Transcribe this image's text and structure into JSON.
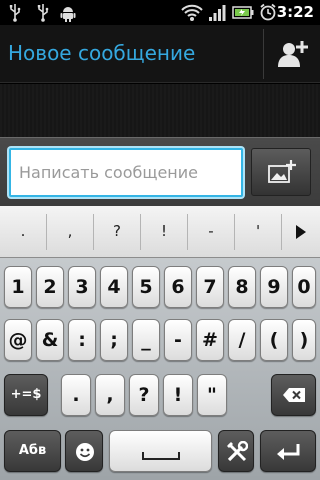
{
  "status_bar": {
    "time": "3:22",
    "icons": [
      "usb-icon",
      "usb-icon",
      "android-debug-icon",
      "wifi-icon",
      "signal-icon",
      "battery-icon",
      "alarm-icon"
    ]
  },
  "action_bar": {
    "title": "Новое сообщение",
    "add_contact_icon": "add-contact-icon"
  },
  "compose": {
    "placeholder": "Написать сообщение",
    "attach_icon": "attach-image-icon"
  },
  "keyboard": {
    "suggestions": [
      ".",
      ",",
      "?",
      "!",
      "-",
      "'"
    ],
    "more_suggestions_icon": "triangle-right-icon",
    "row1": [
      "1",
      "2",
      "3",
      "4",
      "5",
      "6",
      "7",
      "8",
      "9",
      "0"
    ],
    "row2": [
      "@",
      "&",
      ":",
      ";",
      "_",
      "-",
      "#",
      "/",
      "(",
      ")"
    ],
    "row3": {
      "shift": "+=$",
      "keys": [
        ".",
        ",",
        "?",
        "!",
        "\""
      ],
      "delete_icon": "backspace-icon"
    },
    "row4": {
      "lang": "Абв",
      "emoji_icon": "smiley-icon",
      "space_icon": "space-bar-icon",
      "tools_icon": "tools-icon",
      "enter_icon": "enter-icon"
    }
  },
  "colors": {
    "accent": "#35a8df",
    "focus_border": "#34b5e5"
  }
}
